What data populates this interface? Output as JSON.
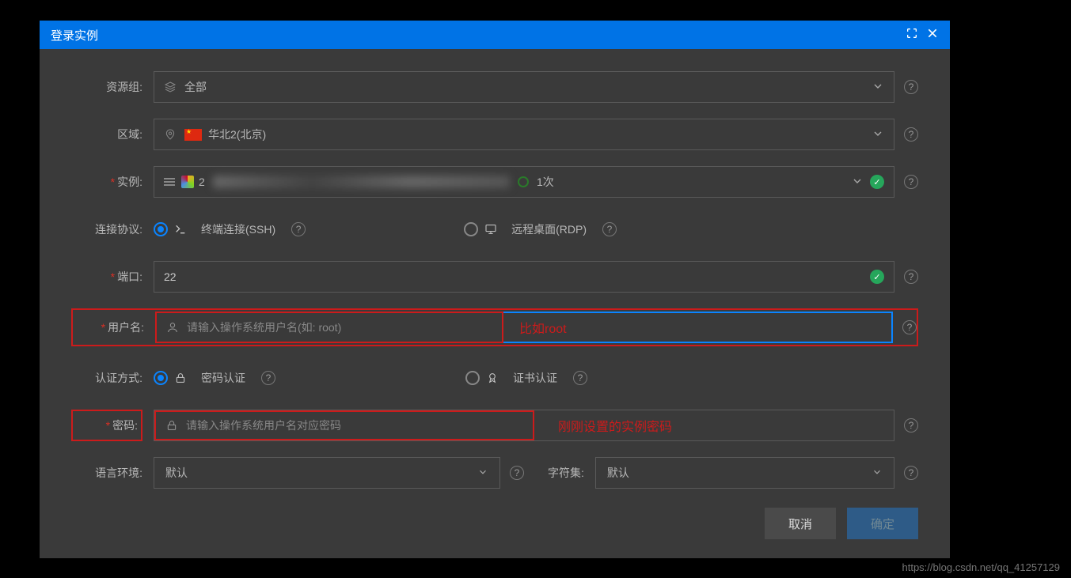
{
  "header": {
    "title": "登录实例"
  },
  "resourceGroup": {
    "label": "资源组:",
    "value": "全部"
  },
  "region": {
    "label": "区域:",
    "value": "华北2(北京)"
  },
  "instance": {
    "label": "实例:",
    "prefix": "2",
    "suffix": "1次"
  },
  "protocol": {
    "label": "连接协议:",
    "ssh": "终端连接(SSH)",
    "rdp": "远程桌面(RDP)"
  },
  "port": {
    "label": "端口:",
    "value": "22"
  },
  "username": {
    "label": "用户名:",
    "placeholder": "请输入操作系统用户名(如: root)",
    "annotation": "比如root"
  },
  "auth": {
    "label": "认证方式:",
    "password": "密码认证",
    "cert": "证书认证"
  },
  "password": {
    "label": "密码:",
    "placeholder": "请输入操作系统用户名对应密码",
    "annotation": "刚刚设置的实例密码"
  },
  "locale": {
    "label": "语言环境:",
    "value": "默认"
  },
  "charset": {
    "label": "字符集:",
    "value": "默认"
  },
  "buttons": {
    "cancel": "取消",
    "ok": "确定"
  },
  "watermark": "https://blog.csdn.net/qq_41257129"
}
